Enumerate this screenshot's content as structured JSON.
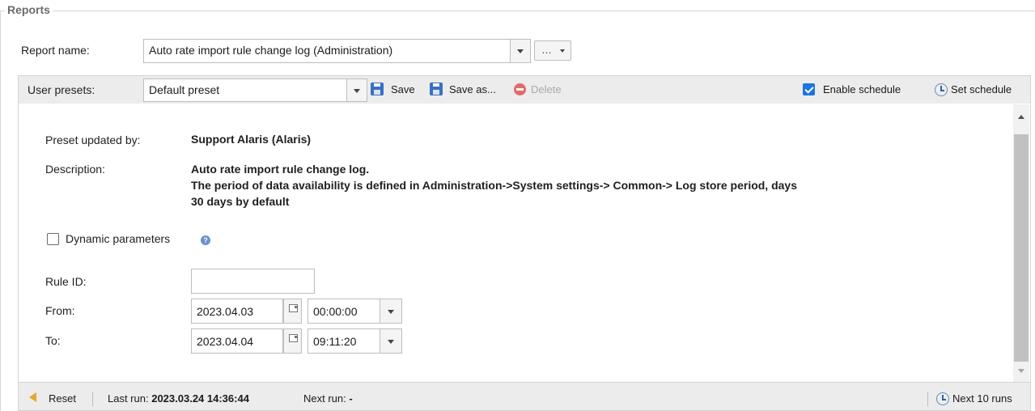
{
  "fieldset": {
    "legend": "Reports"
  },
  "report": {
    "label": "Report name:",
    "value": "Auto rate import rule change log (Administration)",
    "more_label": "…"
  },
  "presets": {
    "label": "User presets:",
    "value": "Default preset",
    "save": "Save",
    "save_as": "Save as...",
    "delete": "Delete",
    "enable_schedule": "Enable schedule",
    "enable_schedule_checked": true,
    "set_schedule": "Set schedule"
  },
  "details": {
    "updated_by_label": "Preset updated by:",
    "updated_by": "Support Alaris (Alaris)",
    "description_label": "Description:",
    "description_lines": [
      "Auto rate import rule change log.",
      "The period of data availability is defined in Administration->System settings-> Common-> Log store period, days",
      "30 days by default"
    ],
    "dynamic_params_label": "Dynamic parameters",
    "dynamic_params_checked": false,
    "help_glyph": "?"
  },
  "params": {
    "rule_id_label": "Rule ID:",
    "rule_id_value": "",
    "from_label": "From:",
    "from_date": "2023.04.03",
    "from_time": "00:00:00",
    "to_label": "To:",
    "to_date": "2023.04.04",
    "to_time": "09:11:20"
  },
  "footer": {
    "reset": "Reset",
    "last_run_label": "Last run:",
    "last_run_value": "2023.03.24 14:36:44",
    "next_run_label": "Next run:",
    "next_run_value": "-",
    "next_10_runs": "Next 10 runs"
  },
  "colors": {
    "accent": "#1f73e0",
    "toolbar_bg": "#ececec",
    "delete": "#e06b6b",
    "save": "#3b6fc4"
  }
}
